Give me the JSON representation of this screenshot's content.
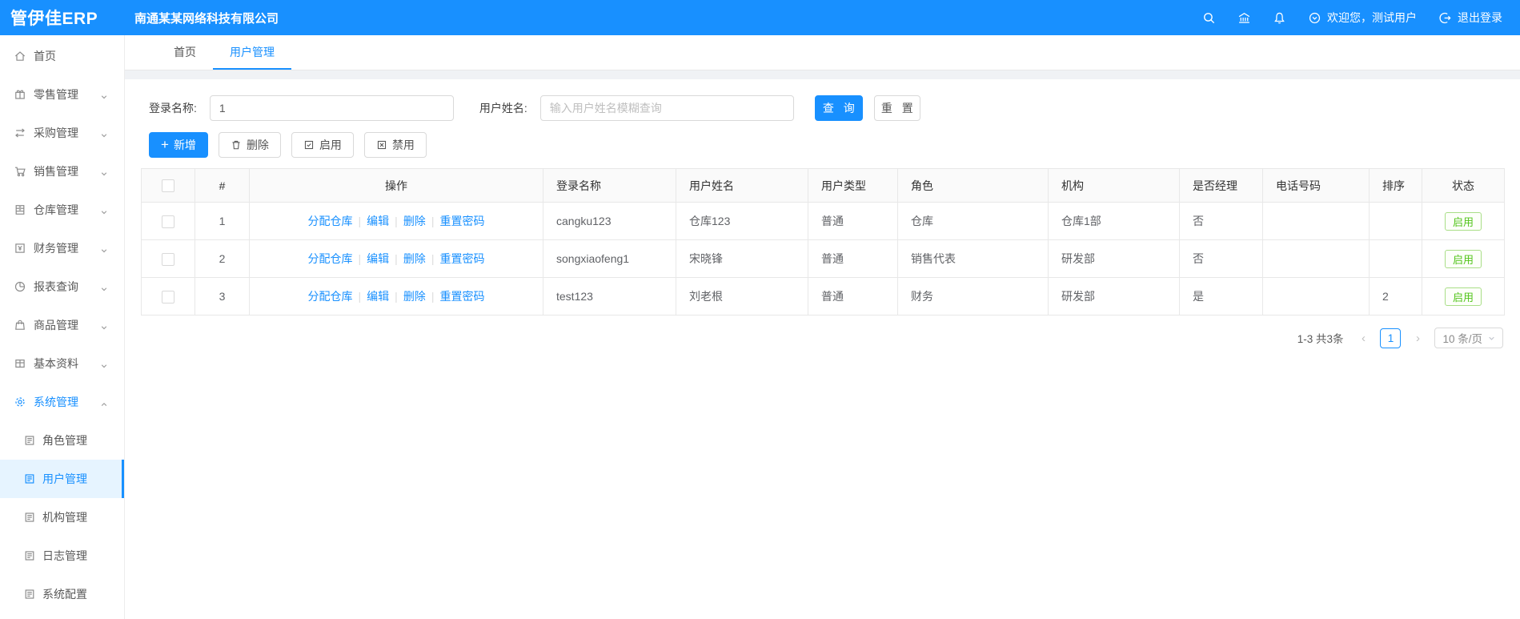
{
  "colors": {
    "primary": "#1890ff",
    "header_bg": "#1890ff",
    "active_sub_bg": "#e6f4ff",
    "tag_green": "#52c41a",
    "table_header_bg": "#fafafa",
    "border": "#e8e8e8"
  },
  "header": {
    "logo": "管伊佳ERP",
    "company": "南通某某网络科技有限公司",
    "icons": [
      "search-icon",
      "bank-icon",
      "bell-icon"
    ],
    "welcome": "欢迎您，测试用户",
    "logout": "退出登录"
  },
  "sidebar": {
    "items": [
      {
        "label": "首页",
        "icon": "home-icon",
        "expandable": false
      },
      {
        "label": "零售管理",
        "icon": "retail-icon",
        "expandable": true
      },
      {
        "label": "采购管理",
        "icon": "purchase-icon",
        "expandable": true
      },
      {
        "label": "销售管理",
        "icon": "sales-cart-icon",
        "expandable": true
      },
      {
        "label": "仓库管理",
        "icon": "warehouse-icon",
        "expandable": true
      },
      {
        "label": "财务管理",
        "icon": "finance-icon",
        "expandable": true
      },
      {
        "label": "报表查询",
        "icon": "report-pie-icon",
        "expandable": true
      },
      {
        "label": "商品管理",
        "icon": "product-bag-icon",
        "expandable": true
      },
      {
        "label": "基本资料",
        "icon": "basic-data-icon",
        "expandable": true
      },
      {
        "label": "系统管理",
        "icon": "gear-icon",
        "expandable": true,
        "expanded": true,
        "active": true,
        "children": [
          {
            "label": "角色管理",
            "icon": "doc-icon"
          },
          {
            "label": "用户管理",
            "icon": "doc-icon",
            "active": true
          },
          {
            "label": "机构管理",
            "icon": "doc-icon"
          },
          {
            "label": "日志管理",
            "icon": "doc-icon"
          },
          {
            "label": "系统配置",
            "icon": "doc-icon"
          }
        ]
      }
    ]
  },
  "tabs": [
    {
      "label": "首页",
      "active": false
    },
    {
      "label": "用户管理",
      "active": true
    }
  ],
  "search": {
    "login_label": "登录名称:",
    "login_value": "1",
    "name_label": "用户姓名:",
    "name_placeholder": "输入用户姓名模糊查询",
    "query_label": "查 询",
    "reset_label": "重 置"
  },
  "toolbar": {
    "add": "新增",
    "delete": "删除",
    "enable": "启用",
    "disable": "禁用"
  },
  "table": {
    "columns": [
      "#",
      "操作",
      "登录名称",
      "用户姓名",
      "用户类型",
      "角色",
      "机构",
      "是否经理",
      "电话号码",
      "排序",
      "状态"
    ],
    "action_labels": [
      "分配仓库",
      "编辑",
      "删除",
      "重置密码"
    ],
    "rows": [
      {
        "index": "1",
        "login_name": "cangku123",
        "user_name": "仓库123",
        "user_type": "普通",
        "role": "仓库",
        "org": "仓库1部",
        "is_manager": "否",
        "phone": "",
        "sort": "",
        "status": "启用"
      },
      {
        "index": "2",
        "login_name": "songxiaofeng1",
        "user_name": "宋晓锋",
        "user_type": "普通",
        "role": "销售代表",
        "org": "研发部",
        "is_manager": "否",
        "phone": "",
        "sort": "",
        "status": "启用"
      },
      {
        "index": "3",
        "login_name": "test123",
        "user_name": "刘老根",
        "user_type": "普通",
        "role": "财务",
        "org": "研发部",
        "is_manager": "是",
        "phone": "",
        "sort": "2",
        "status": "启用"
      }
    ]
  },
  "pagination": {
    "total": "1-3 共3条",
    "prev": "‹",
    "page": "1",
    "next": "›",
    "page_size": "10 条/页"
  }
}
